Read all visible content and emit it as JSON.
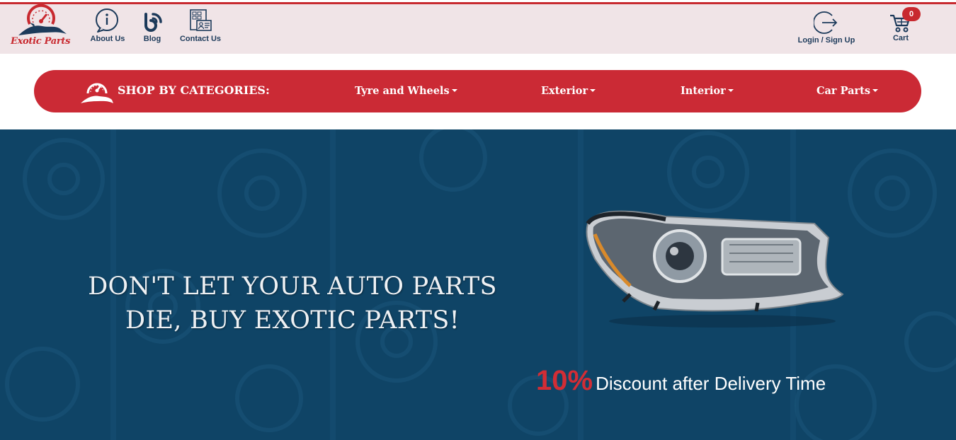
{
  "brand": {
    "name": "Exotic Parts"
  },
  "top_nav": {
    "about": "About Us",
    "blog": "Blog",
    "contact": "Contact Us",
    "login": "Login / Sign Up",
    "cart": "Cart",
    "cart_count": "0"
  },
  "categories": {
    "title": "SHOP BY CATEGORIES:",
    "items": [
      "Tyre and Wheels",
      "Exterior",
      "Interior",
      "Car Parts"
    ]
  },
  "hero": {
    "headline_line1": "DON'T LET YOUR AUTO PARTS",
    "headline_line2": "DIE, BUY EXOTIC PARTS!",
    "promo_percent": "10%",
    "promo_text": "Discount after Delivery Time"
  },
  "colors": {
    "brand_red": "#c8292f",
    "navy": "#1c3a5a",
    "topbar_bg": "#f0e4e7",
    "hero_bg": "#0f4466"
  },
  "icons": [
    "logo-speedometer-icon",
    "info-icon",
    "blog-icon",
    "contact-card-icon",
    "login-icon",
    "cart-icon",
    "chevron-down-icon",
    "headlamp-image"
  ]
}
